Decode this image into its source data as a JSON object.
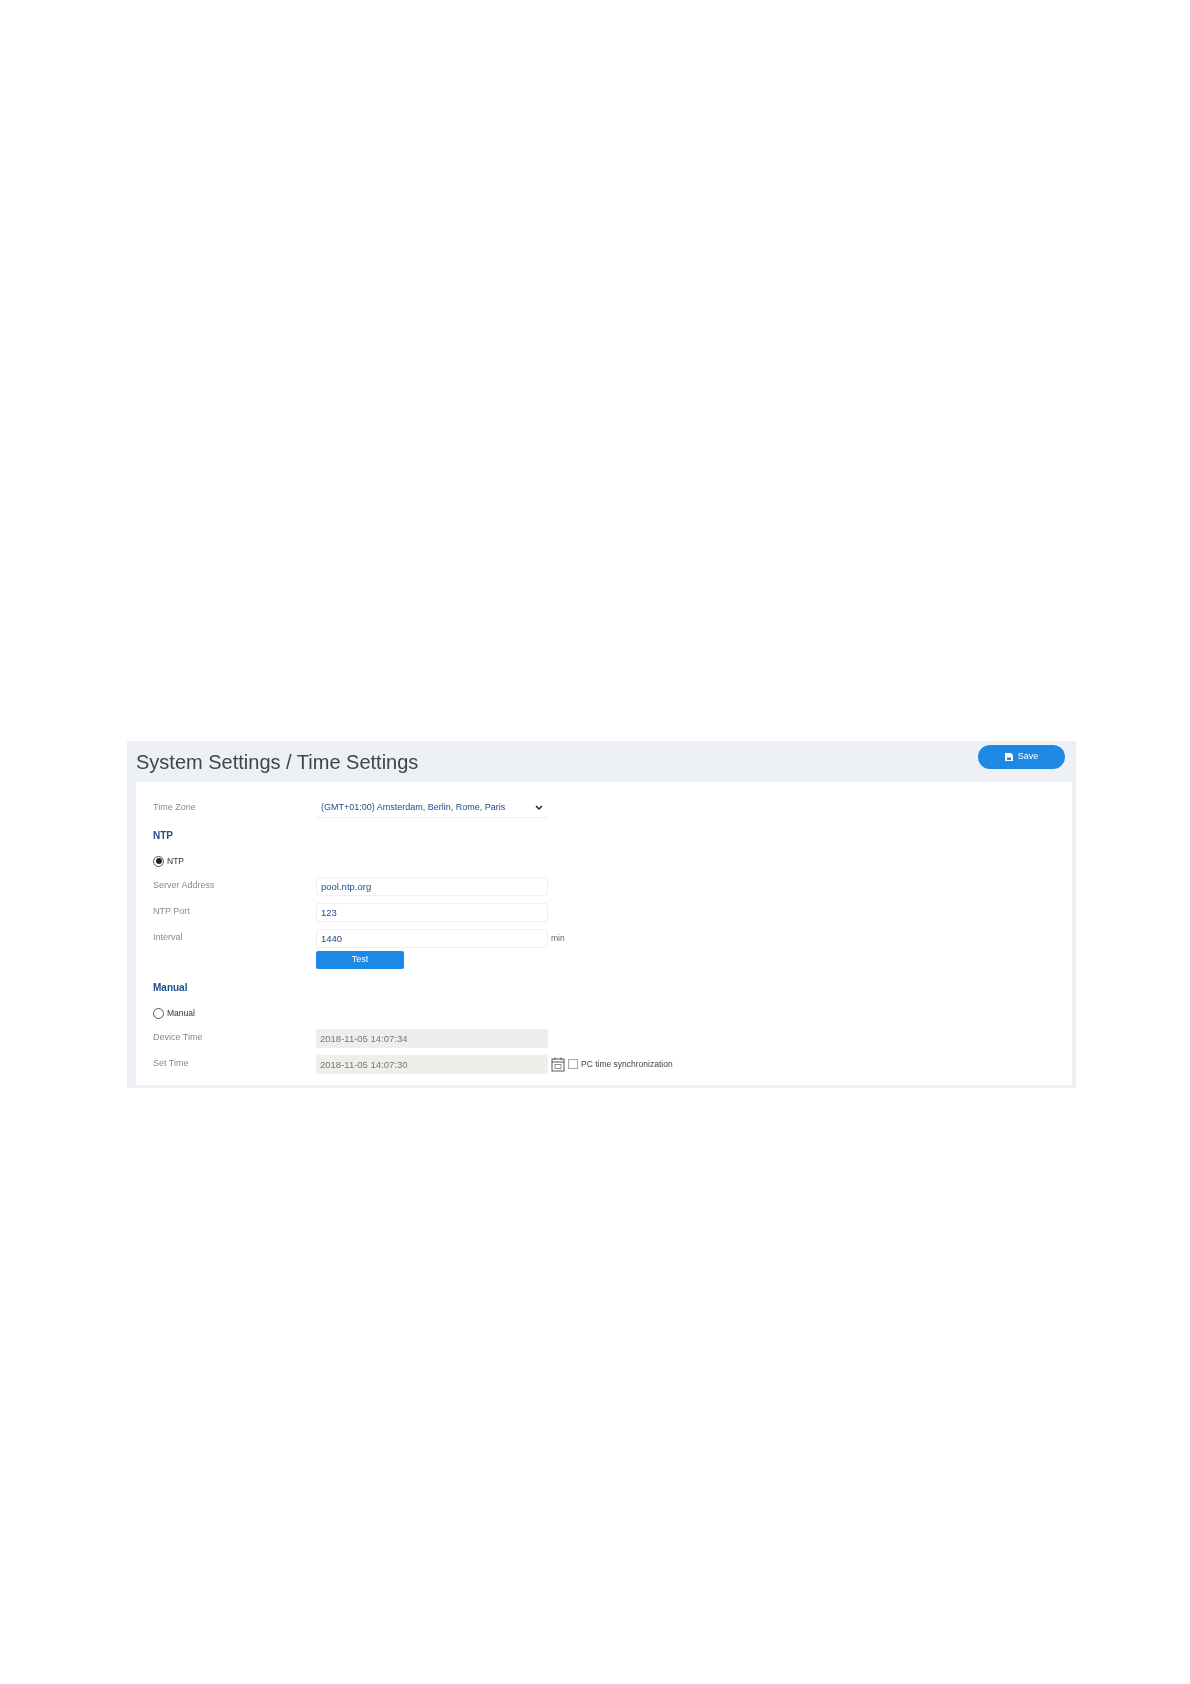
{
  "header": {
    "title": "System Settings / Time Settings",
    "save_button": "Save"
  },
  "time_zone": {
    "label": "Time Zone",
    "value": "(GMT+01:00) Amsterdam, Berlin, Rome, Paris"
  },
  "sections": [
    {
      "heading": "NTP",
      "option": {
        "label": "NTP",
        "selected": true
      },
      "rows": [
        {
          "kind": "input",
          "label": "Server Address",
          "value": "pool.ntp.org"
        },
        {
          "kind": "input",
          "label": "NTP Port",
          "value": "123"
        },
        {
          "kind": "input",
          "label": "Interval",
          "value": "1440",
          "unit": "min"
        }
      ],
      "button": "Test"
    },
    {
      "heading": "Manual",
      "option": {
        "label": "Manual",
        "selected": false
      },
      "rows": [
        {
          "kind": "readonly",
          "label": "Device Time",
          "value": "2018-11-05 14:07:34"
        },
        {
          "kind": "datetime",
          "label": "Set Time",
          "value": "2018-11-05 14:07:30",
          "checkbox": {
            "label": "PC time synchronization",
            "checked": false
          }
        }
      ]
    }
  ]
}
